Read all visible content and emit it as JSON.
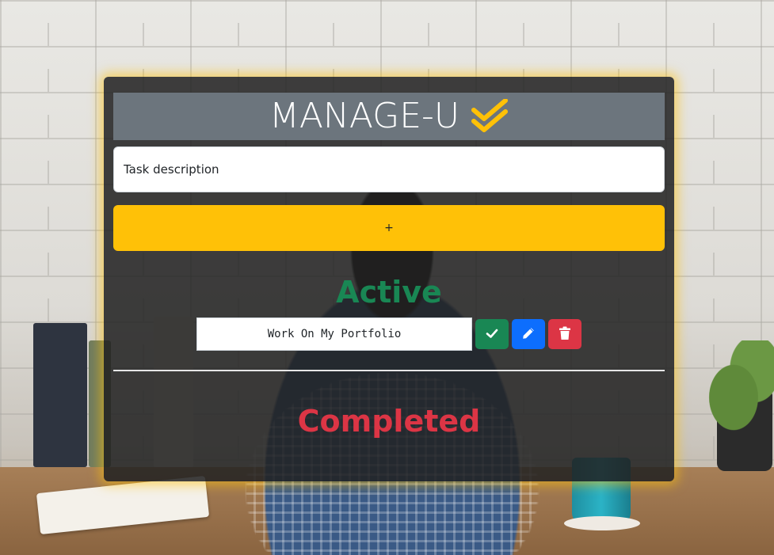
{
  "app": {
    "title": "MANAGE-U",
    "brand_icon": "double-check-icon",
    "accent_color": "#ffc107"
  },
  "form": {
    "task_placeholder": "Task description",
    "add_button_label": "+"
  },
  "sections": {
    "active_heading": "Active",
    "completed_heading": "Completed"
  },
  "active_tasks": [
    {
      "text": "Work On My Portfolio",
      "actions": [
        "check-icon",
        "pencil-icon",
        "trash-icon"
      ]
    }
  ],
  "completed_tasks": [],
  "colors": {
    "active": "#198754",
    "completed": "#dc3545",
    "edit": "#0d6efd",
    "header_bg": "#6c757d"
  }
}
